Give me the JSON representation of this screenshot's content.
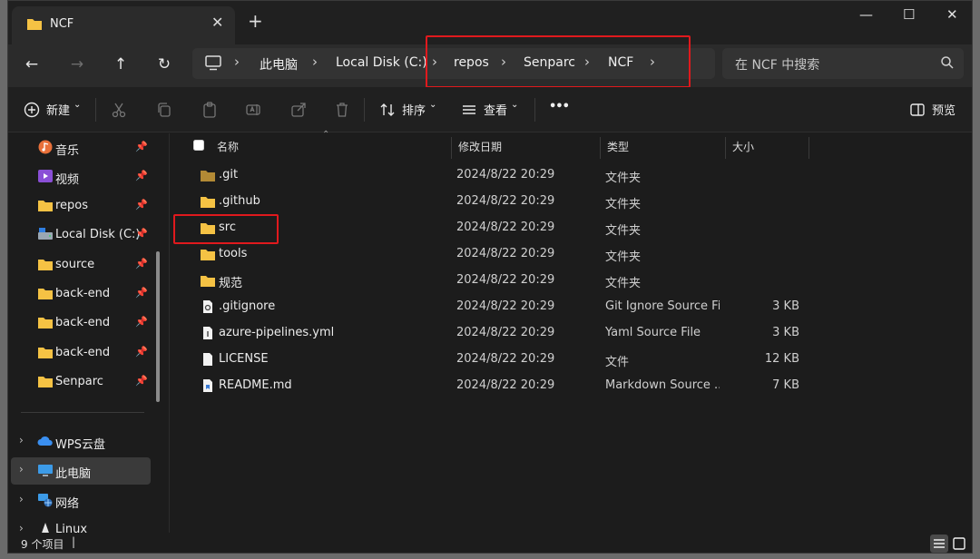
{
  "tab": {
    "title": "NCF",
    "close": "✕",
    "new_tab": "+"
  },
  "window_controls": {
    "minimize": "—",
    "maximize": "☐",
    "close": "✕"
  },
  "nav": {
    "back": "←",
    "forward": "→",
    "up": "↑",
    "refresh": "↻"
  },
  "breadcrumb": [
    "此电脑",
    "Local Disk (C:)",
    "repos",
    "Senparc",
    "NCF"
  ],
  "search": {
    "placeholder": "在 NCF 中搜索"
  },
  "toolbar": {
    "new_label": "新建",
    "sort_label": "排序",
    "view_label": "查看",
    "more_label": "•••",
    "preview_label": "预览"
  },
  "sidebar": {
    "pinned": [
      {
        "label": "音乐",
        "icon": "music-icon"
      },
      {
        "label": "视频",
        "icon": "video-icon"
      },
      {
        "label": "repos",
        "icon": "folder-icon"
      },
      {
        "label": "Local Disk (C:)",
        "icon": "drive-icon"
      },
      {
        "label": "source",
        "icon": "folder-icon"
      },
      {
        "label": "back-end",
        "icon": "folder-icon"
      },
      {
        "label": "back-end",
        "icon": "folder-icon"
      },
      {
        "label": "back-end",
        "icon": "folder-icon"
      },
      {
        "label": "Senparc",
        "icon": "folder-icon"
      }
    ],
    "tree": [
      {
        "label": "WPS云盘",
        "icon": "cloud-icon"
      },
      {
        "label": "此电脑",
        "icon": "computer-icon",
        "selected": true
      },
      {
        "label": "网络",
        "icon": "network-icon"
      },
      {
        "label": "Linux",
        "icon": "linux-icon"
      }
    ]
  },
  "columns": {
    "name": "名称",
    "date": "修改日期",
    "type": "类型",
    "size": "大小"
  },
  "files": [
    {
      "name": ".git",
      "date": "2024/8/22 20:29",
      "type": "文件夹",
      "size": "",
      "icon": "folder-dim-icon"
    },
    {
      "name": ".github",
      "date": "2024/8/22 20:29",
      "type": "文件夹",
      "size": "",
      "icon": "folder-icon"
    },
    {
      "name": "src",
      "date": "2024/8/22 20:29",
      "type": "文件夹",
      "size": "",
      "icon": "folder-icon"
    },
    {
      "name": "tools",
      "date": "2024/8/22 20:29",
      "type": "文件夹",
      "size": "",
      "icon": "folder-icon"
    },
    {
      "name": "规范",
      "date": "2024/8/22 20:29",
      "type": "文件夹",
      "size": "",
      "icon": "folder-icon"
    },
    {
      "name": ".gitignore",
      "date": "2024/8/22 20:29",
      "type": "Git Ignore Source Fi...",
      "size": "3 KB",
      "icon": "settings-file-icon"
    },
    {
      "name": "azure-pipelines.yml",
      "date": "2024/8/22 20:29",
      "type": "Yaml Source File",
      "size": "3 KB",
      "icon": "yaml-file-icon"
    },
    {
      "name": "LICENSE",
      "date": "2024/8/22 20:29",
      "type": "文件",
      "size": "12 KB",
      "icon": "file-icon"
    },
    {
      "name": "README.md",
      "date": "2024/8/22 20:29",
      "type": "Markdown Source ...",
      "size": "7 KB",
      "icon": "markdown-file-icon"
    }
  ],
  "status": {
    "count_text": "9 个项目"
  },
  "colors": {
    "folder": "#f5c244",
    "highlight": "#e0191d",
    "background": "#1c1c1c"
  }
}
